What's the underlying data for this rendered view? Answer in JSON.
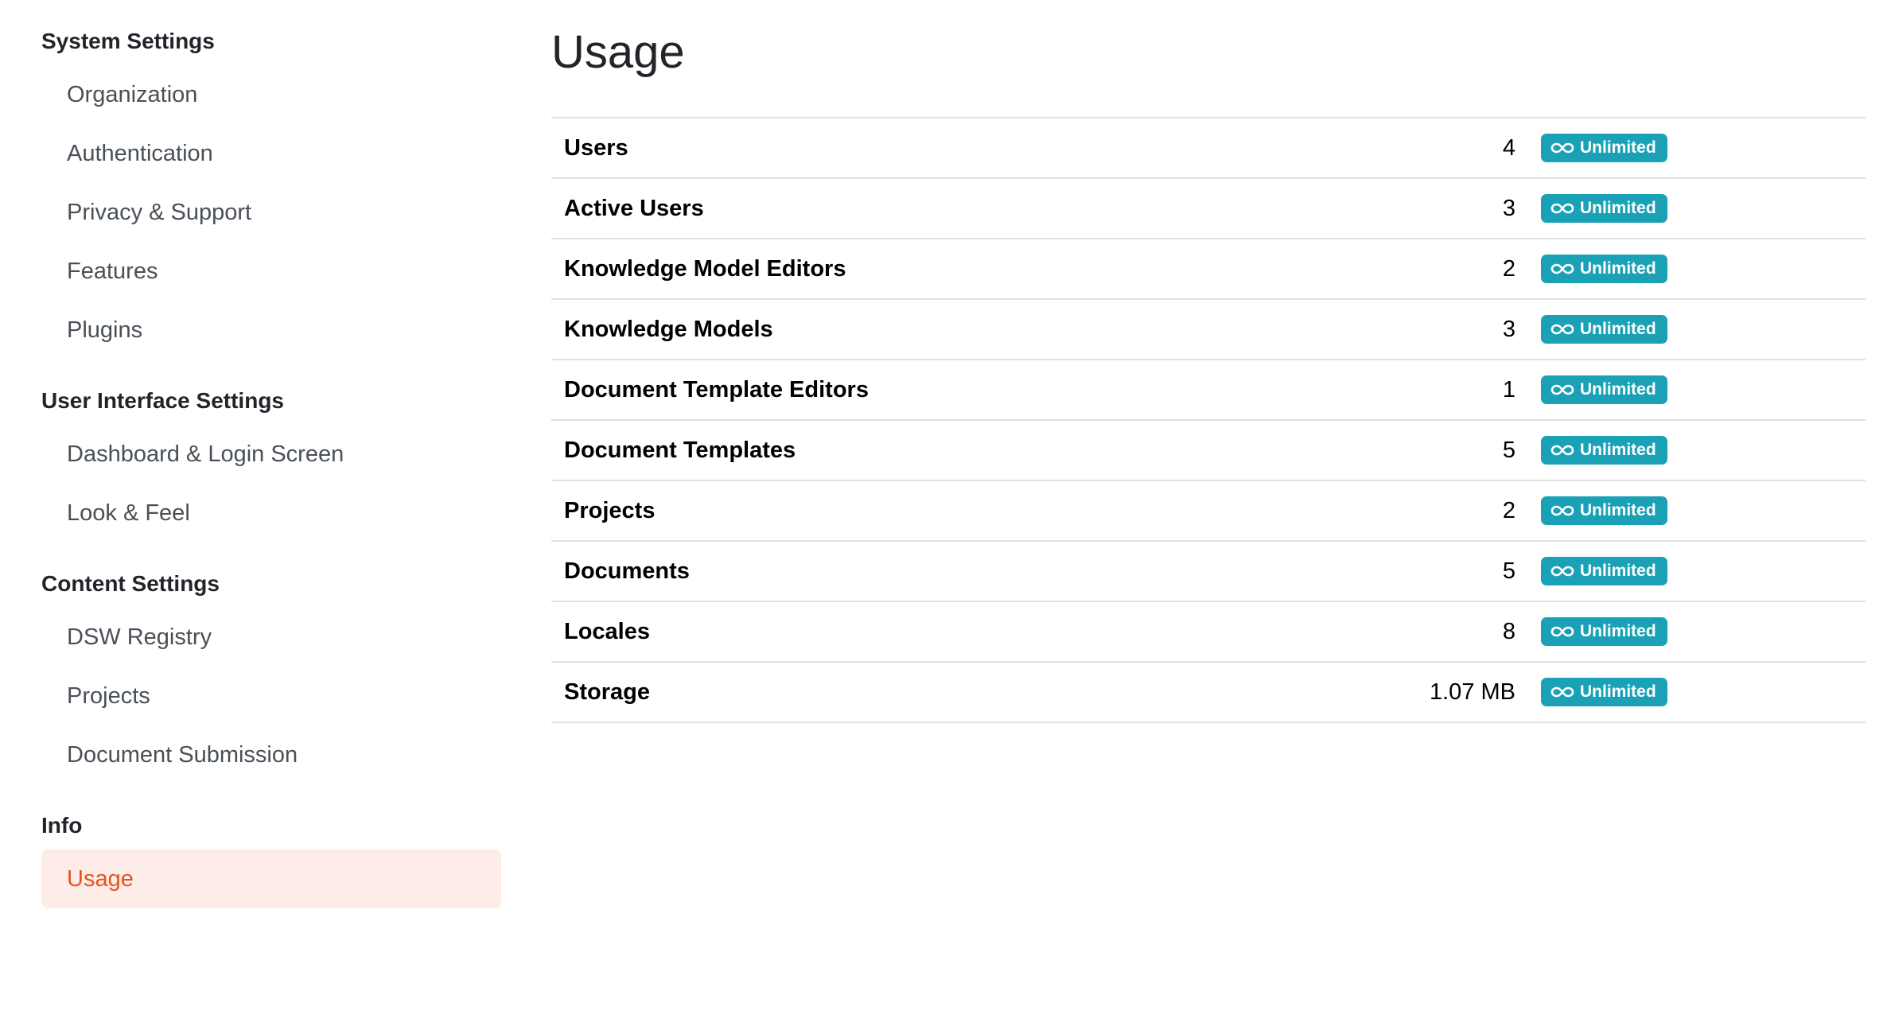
{
  "sidebar": {
    "sections": [
      {
        "title": "System Settings",
        "items": [
          "Organization",
          "Authentication",
          "Privacy & Support",
          "Features",
          "Plugins"
        ]
      },
      {
        "title": "User Interface Settings",
        "items": [
          "Dashboard & Login Screen",
          "Look & Feel"
        ]
      },
      {
        "title": "Content Settings",
        "items": [
          "DSW Registry",
          "Projects",
          "Document Submission"
        ]
      },
      {
        "title": "Info",
        "items": [
          "Usage"
        ]
      }
    ],
    "active_item": "Usage"
  },
  "main": {
    "title": "Usage",
    "rows": [
      {
        "label": "Users",
        "value": "4",
        "limit": "Unlimited"
      },
      {
        "label": "Active Users",
        "value": "3",
        "limit": "Unlimited"
      },
      {
        "label": "Knowledge Model Editors",
        "value": "2",
        "limit": "Unlimited"
      },
      {
        "label": "Knowledge Models",
        "value": "3",
        "limit": "Unlimited"
      },
      {
        "label": "Document Template Editors",
        "value": "1",
        "limit": "Unlimited"
      },
      {
        "label": "Document Templates",
        "value": "5",
        "limit": "Unlimited"
      },
      {
        "label": "Projects",
        "value": "2",
        "limit": "Unlimited"
      },
      {
        "label": "Documents",
        "value": "5",
        "limit": "Unlimited"
      },
      {
        "label": "Locales",
        "value": "8",
        "limit": "Unlimited"
      },
      {
        "label": "Storage",
        "value": "1.07 MB",
        "limit": "Unlimited"
      }
    ],
    "badge_icon": "infinity-icon"
  },
  "colors": {
    "accent": "#e8531d",
    "active_bg": "#fdece7",
    "badge": "#1aa1b6",
    "divider": "#dee2e6"
  }
}
